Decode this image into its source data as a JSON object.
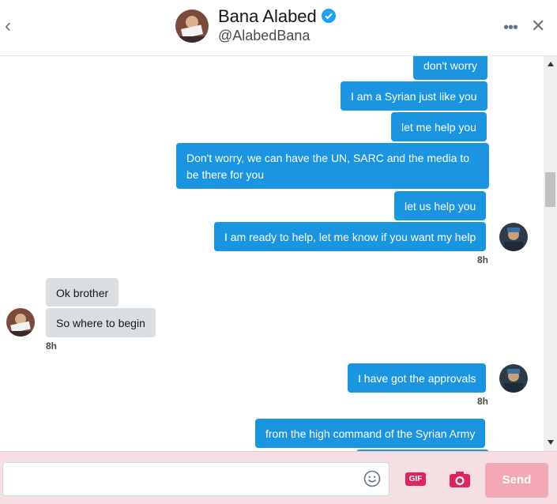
{
  "header": {
    "name": "Bana Alabed",
    "handle": "@AlabedBana"
  },
  "messages": [
    {
      "text": "don't worry",
      "side": "sent"
    },
    {
      "text": "I am a Syrian just like you",
      "side": "sent"
    },
    {
      "text": "let me help you",
      "side": "sent"
    },
    {
      "text": "Don't worry, we can have the UN, SARC and the media to be there for you",
      "side": "sent"
    },
    {
      "text": "let us help you",
      "side": "sent"
    },
    {
      "text": "I am ready to help, let me know if you want my help",
      "side": "sent"
    },
    {
      "text": "Ok brother",
      "side": "received"
    },
    {
      "text": "So where to begin",
      "side": "received"
    },
    {
      "text": "I have got the approvals",
      "side": "sent"
    },
    {
      "text": "from the high command of the Syrian Army",
      "side": "sent"
    }
  ],
  "timestamps": [
    "8h",
    "8h",
    "8h"
  ],
  "compose": {
    "placeholder": "",
    "gif_label": "GIF",
    "send_label": "Send"
  },
  "icons": {
    "back": "chevron-left-icon",
    "verified": "verified-badge-icon",
    "more": "more-icon",
    "close": "close-icon",
    "emoji": "emoji-icon",
    "gif": "gif-icon",
    "camera": "camera-icon"
  },
  "colors": {
    "sent_bubble": "#1b95e0",
    "received_bubble": "#d9dee3",
    "send_button": "#f4a7b4",
    "compose_bg": "#f6dfe2",
    "accent": "#e0245e"
  }
}
